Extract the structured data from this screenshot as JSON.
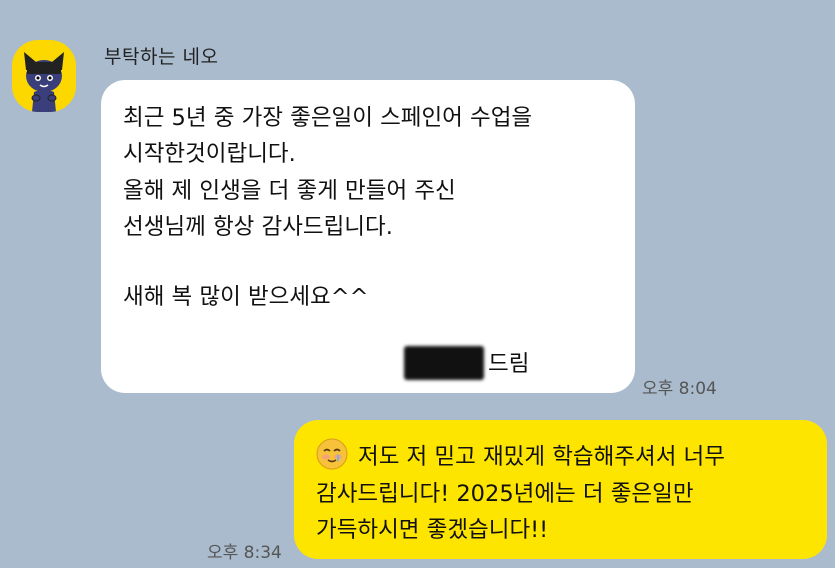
{
  "sender": {
    "name": "부탁하는 네오"
  },
  "incoming_message": {
    "lines": [
      "최근 5년 중 가장 좋은일이 스페인어 수업을",
      "시작한것이랍니다.",
      "올해 제 인생을 더 좋게 만들어 주신",
      "선생님께 항상 감사드립니다.",
      "새해 복 많이 받으세요^^"
    ],
    "signature_suffix": "드림",
    "time": "오후 8:04"
  },
  "outgoing_message": {
    "emoji": "emoji-icon",
    "first_line": "저도 저 믿고 재밌게 학습해주셔서 너무",
    "lines": [
      "감사드립니다! 2025년에는 더 좋은일만",
      "가득하시면 좋겠습니다!!"
    ],
    "time": "오후 8:34"
  },
  "colors": {
    "background": "#a9bbcd",
    "incoming_bubble": "#ffffff",
    "outgoing_bubble": "#fee500",
    "avatar_bg": "#fcd800"
  }
}
